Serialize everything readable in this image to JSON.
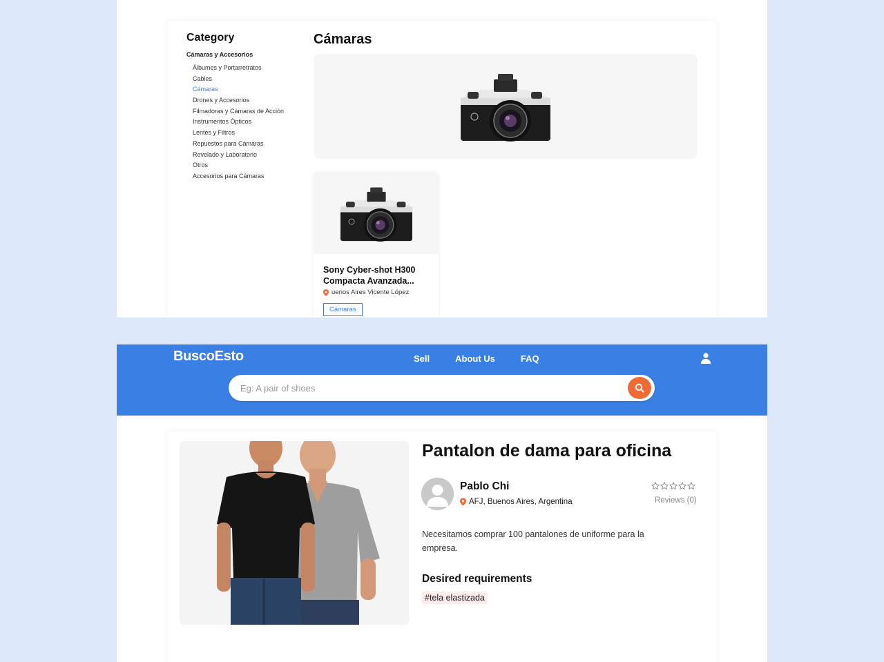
{
  "top": {
    "sidebar": {
      "heading": "Category",
      "parent": "Cámaras y Accesorios",
      "items": [
        {
          "label": "Álbumes y Portarretratos"
        },
        {
          "label": "Cables"
        },
        {
          "label": "Cámaras"
        },
        {
          "label": "Drones y Accesorios"
        },
        {
          "label": "Filmadoras y Cámaras de Acción"
        },
        {
          "label": "Instrumentos Ópticos"
        },
        {
          "label": "Lentes y Filtros"
        },
        {
          "label": "Repuestos para Cámaras"
        },
        {
          "label": "Revelado y Laboratorio"
        },
        {
          "label": "Otros"
        },
        {
          "label": "Accesorios para Cámaras"
        }
      ],
      "active_index": 2
    },
    "section_title": "Cámaras",
    "product": {
      "title": "Sony Cyber-shot H300 Compacta Avanzada...",
      "location": "uenos Aires Vicente López",
      "category_tag": "Cámaras"
    }
  },
  "bottom": {
    "navbar": {
      "logo": "BuscoEsto",
      "links": [
        "Sell",
        "About Us",
        "FAQ"
      ],
      "search_placeholder": "Eg: A pair of shoes"
    },
    "listing": {
      "title": "Pantalon de dama para oficina",
      "seller_name": "Pablo Chi",
      "seller_location": "AFJ, Buenos Aires, Argentina",
      "rating": 0,
      "reviews_label": "Reviews (0)",
      "description": "Necesitamos comprar 100 pantalones de uniforme para la empresa.",
      "requirements_heading": "Desired requirements",
      "requirement_tags": [
        "#tela elastizada"
      ]
    }
  },
  "colors": {
    "background": "#dde8fb",
    "brand_blue": "#3a7fe4",
    "accent_orange": "#f06a35",
    "link_blue": "#3b7fe6"
  }
}
